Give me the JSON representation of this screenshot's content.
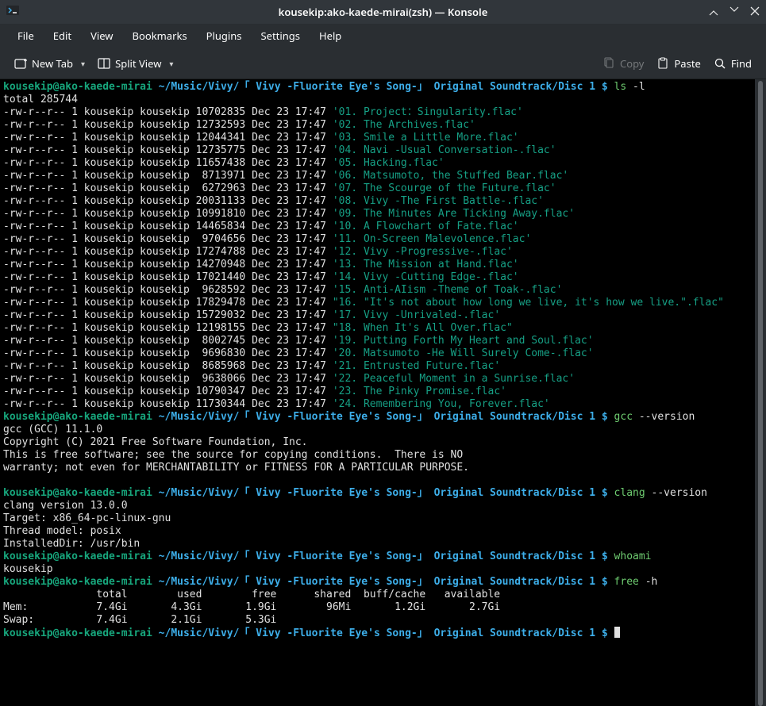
{
  "window": {
    "title": "kousekip:ako-kaede-mirai(zsh) — Konsole"
  },
  "menubar": [
    "File",
    "Edit",
    "View",
    "Bookmarks",
    "Plugins",
    "Settings",
    "Help"
  ],
  "toolbar": {
    "new_tab": "New Tab",
    "split_view": "Split View",
    "copy": "Copy",
    "paste": "Paste",
    "find": "Find"
  },
  "prompt": {
    "user_host": "kousekip@ako-kaede-mirai",
    "path": "~/Music/Vivy/「 Vivy -Fluorite Eye's Song-」 Original Soundtrack/Disc 1",
    "dollar": "$"
  },
  "commands": {
    "ls": {
      "cmd": "ls",
      "arg": "-l"
    },
    "gcc": {
      "cmd": "gcc",
      "arg": "--version"
    },
    "clang": {
      "cmd": "clang",
      "arg": "--version"
    },
    "whoami": {
      "cmd": "whoami"
    },
    "free": {
      "cmd": "free",
      "arg": "-h"
    }
  },
  "ls_total": "total 285744",
  "files": [
    {
      "perm": "-rw-r--r--",
      "n": "1",
      "u": "kousekip",
      "g": "kousekip",
      "size": "10702835",
      "date": "Dec 23 17:47",
      "name": "'01. Project：Singularity.flac'"
    },
    {
      "perm": "-rw-r--r--",
      "n": "1",
      "u": "kousekip",
      "g": "kousekip",
      "size": "12732593",
      "date": "Dec 23 17:47",
      "name": "'02. The Archives.flac'"
    },
    {
      "perm": "-rw-r--r--",
      "n": "1",
      "u": "kousekip",
      "g": "kousekip",
      "size": "12044341",
      "date": "Dec 23 17:47",
      "name": "'03. Smile a Little More.flac'"
    },
    {
      "perm": "-rw-r--r--",
      "n": "1",
      "u": "kousekip",
      "g": "kousekip",
      "size": "12735775",
      "date": "Dec 23 17:47",
      "name": "'04. Navi -Usual Conversation-.flac'"
    },
    {
      "perm": "-rw-r--r--",
      "n": "1",
      "u": "kousekip",
      "g": "kousekip",
      "size": "11657438",
      "date": "Dec 23 17:47",
      "name": "'05. Hacking.flac'"
    },
    {
      "perm": "-rw-r--r--",
      "n": "1",
      "u": "kousekip",
      "g": "kousekip",
      "size": " 8713971",
      "date": "Dec 23 17:47",
      "name": "'06. Matsumoto, the Stuffed Bear.flac'"
    },
    {
      "perm": "-rw-r--r--",
      "n": "1",
      "u": "kousekip",
      "g": "kousekip",
      "size": " 6272963",
      "date": "Dec 23 17:47",
      "name": "'07. The Scourge of the Future.flac'"
    },
    {
      "perm": "-rw-r--r--",
      "n": "1",
      "u": "kousekip",
      "g": "kousekip",
      "size": "20031133",
      "date": "Dec 23 17:47",
      "name": "'08. Vivy -The First Battle-.flac'"
    },
    {
      "perm": "-rw-r--r--",
      "n": "1",
      "u": "kousekip",
      "g": "kousekip",
      "size": "10991810",
      "date": "Dec 23 17:47",
      "name": "'09. The Minutes Are Ticking Away.flac'"
    },
    {
      "perm": "-rw-r--r--",
      "n": "1",
      "u": "kousekip",
      "g": "kousekip",
      "size": "14465834",
      "date": "Dec 23 17:47",
      "name": "'10. A Flowchart of Fate.flac'"
    },
    {
      "perm": "-rw-r--r--",
      "n": "1",
      "u": "kousekip",
      "g": "kousekip",
      "size": " 9704656",
      "date": "Dec 23 17:47",
      "name": "'11. On-Screen Malevolence.flac'"
    },
    {
      "perm": "-rw-r--r--",
      "n": "1",
      "u": "kousekip",
      "g": "kousekip",
      "size": "17274788",
      "date": "Dec 23 17:47",
      "name": "'12. Vivy -Progressive-.flac'"
    },
    {
      "perm": "-rw-r--r--",
      "n": "1",
      "u": "kousekip",
      "g": "kousekip",
      "size": "14270948",
      "date": "Dec 23 17:47",
      "name": "'13. The Mission at Hand.flac'"
    },
    {
      "perm": "-rw-r--r--",
      "n": "1",
      "u": "kousekip",
      "g": "kousekip",
      "size": "17021440",
      "date": "Dec 23 17:47",
      "name": "'14. Vivy -Cutting Edge-.flac'"
    },
    {
      "perm": "-rw-r--r--",
      "n": "1",
      "u": "kousekip",
      "g": "kousekip",
      "size": " 9628592",
      "date": "Dec 23 17:47",
      "name": "'15. Anti-AIism -Theme of Toak-.flac'"
    },
    {
      "perm": "-rw-r--r--",
      "n": "1",
      "u": "kousekip",
      "g": "kousekip",
      "size": "17829478",
      "date": "Dec 23 17:47",
      "name": "\"16. \"It's not about how long we live, it's how we live.\".flac\""
    },
    {
      "perm": "-rw-r--r--",
      "n": "1",
      "u": "kousekip",
      "g": "kousekip",
      "size": "15729032",
      "date": "Dec 23 17:47",
      "name": "'17. Vivy -Unrivaled-.flac'"
    },
    {
      "perm": "-rw-r--r--",
      "n": "1",
      "u": "kousekip",
      "g": "kousekip",
      "size": "12198155",
      "date": "Dec 23 17:47",
      "name": "\"18. When It's All Over.flac\""
    },
    {
      "perm": "-rw-r--r--",
      "n": "1",
      "u": "kousekip",
      "g": "kousekip",
      "size": " 8002745",
      "date": "Dec 23 17:47",
      "name": "'19. Putting Forth My Heart and Soul.flac'"
    },
    {
      "perm": "-rw-r--r--",
      "n": "1",
      "u": "kousekip",
      "g": "kousekip",
      "size": " 9696830",
      "date": "Dec 23 17:47",
      "name": "'20. Matsumoto -He Will Surely Come-.flac'"
    },
    {
      "perm": "-rw-r--r--",
      "n": "1",
      "u": "kousekip",
      "g": "kousekip",
      "size": " 8685968",
      "date": "Dec 23 17:47",
      "name": "'21. Entrusted Future.flac'"
    },
    {
      "perm": "-rw-r--r--",
      "n": "1",
      "u": "kousekip",
      "g": "kousekip",
      "size": " 9638066",
      "date": "Dec 23 17:47",
      "name": "'22. Peaceful Moment in a Sunrise.flac'"
    },
    {
      "perm": "-rw-r--r--",
      "n": "1",
      "u": "kousekip",
      "g": "kousekip",
      "size": "10790347",
      "date": "Dec 23 17:47",
      "name": "'23. The Pinky Promise.flac'"
    },
    {
      "perm": "-rw-r--r--",
      "n": "1",
      "u": "kousekip",
      "g": "kousekip",
      "size": "11730344",
      "date": "Dec 23 17:47",
      "name": "'24. Remembering You, Forever.flac'"
    }
  ],
  "gcc_out": [
    "gcc (GCC) 11.1.0",
    "Copyright (C) 2021 Free Software Foundation, Inc.",
    "This is free software; see the source for copying conditions.  There is NO",
    "warranty; not even for MERCHANTABILITY or FITNESS FOR A PARTICULAR PURPOSE.",
    ""
  ],
  "clang_out": [
    "clang version 13.0.0",
    "Target: x86_64-pc-linux-gnu",
    "Thread model: posix",
    "InstalledDir: /usr/bin"
  ],
  "whoami_out": [
    "kousekip"
  ],
  "free_out": [
    "               total        used        free      shared  buff/cache   available",
    "Mem:           7.4Gi       4.3Gi       1.9Gi        96Mi       1.2Gi       2.7Gi",
    "Swap:          7.4Gi       2.1Gi       5.3Gi"
  ]
}
